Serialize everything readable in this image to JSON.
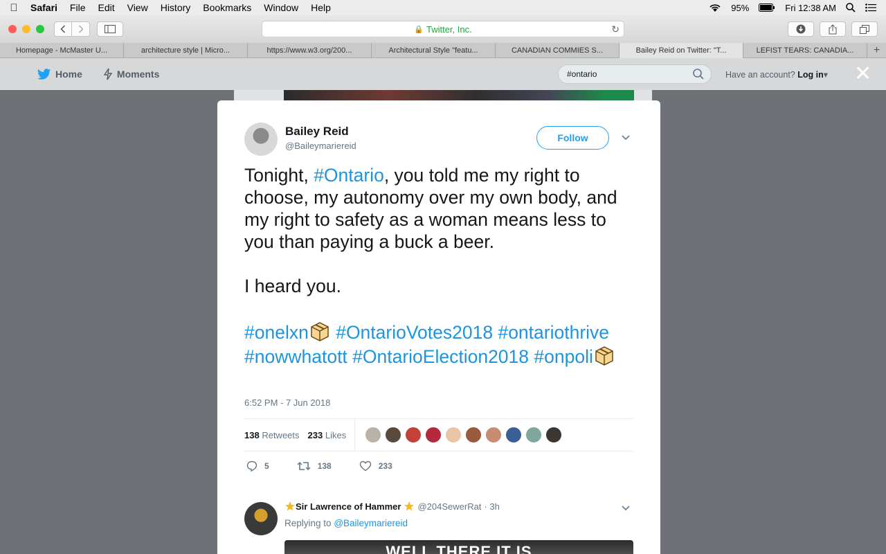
{
  "menubar": {
    "app": "Safari",
    "items": [
      "File",
      "Edit",
      "View",
      "History",
      "Bookmarks",
      "Window",
      "Help"
    ],
    "battery": "95%",
    "clock": "Fri 12:38 AM"
  },
  "toolbar": {
    "address": "Twitter, Inc."
  },
  "tabs": [
    {
      "label": "Homepage - McMaster U..."
    },
    {
      "label": "architecture style | Micro..."
    },
    {
      "label": "https://www.w3.org/200..."
    },
    {
      "label": "Architectural Style \"featu..."
    },
    {
      "label": "CANADIAN COMMIES S..."
    },
    {
      "label": "Bailey Reid on Twitter: \"T..."
    },
    {
      "label": "LEFIST TEARS: CANADIA..."
    }
  ],
  "twitter_header": {
    "home": "Home",
    "moments": "Moments",
    "search_value": "#ontario",
    "account_prompt": "Have an account?",
    "login": "Log in"
  },
  "tweet": {
    "name": "Bailey Reid",
    "handle": "@Baileymariereid",
    "follow": "Follow",
    "line1_pre": "Tonight, ",
    "line1_tag": "#Ontario",
    "line1_post": ", you told me my right to choose, my autonomy over my own body, and my right to safety as a woman means less to you than paying a buck a beer.",
    "line2": "I heard you.",
    "tags_a": "#onelxn",
    "tags_b": "#OntarioVotes2018 #ontariothrive #nowwhatott #OntarioElection2018",
    "tags_c": "#onpoli",
    "timestamp": "6:52 PM - 7 Jun 2018",
    "retweets_count": "138",
    "retweets_label": "Retweets",
    "likes_count": "233",
    "likes_label": "Likes",
    "replies": "5",
    "retweets": "138",
    "likes": "233"
  },
  "reply": {
    "name": "Sir Lawrence of Hammer",
    "handle": "@204SewerRat",
    "time": "· 3h",
    "replying_label": "Replying to",
    "replying_to": "@Baileymariereid",
    "meme_text": "WELL THERE IT IS"
  },
  "colors": {
    "twitter_blue": "#1da1f2",
    "hashtag": "#1b95e0",
    "muted": "#657786"
  }
}
